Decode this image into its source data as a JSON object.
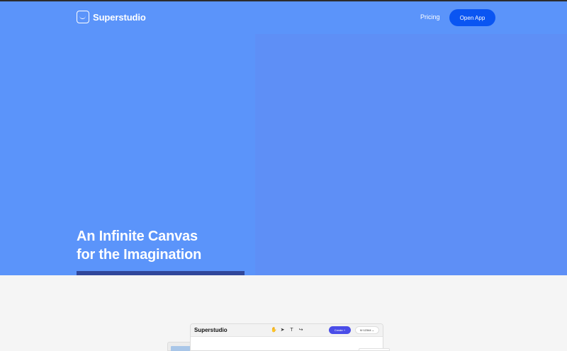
{
  "brand": {
    "name": "Superstudio"
  },
  "nav": {
    "pricing_label": "Pricing",
    "open_app_label": "Open App"
  },
  "hero": {
    "headline_line1": "An Infinite Canvas",
    "headline_line2": "for the Imagination",
    "background_color": "#5b94fa",
    "accent_color": "#0a55f2"
  },
  "preview": {
    "brand_name": "Superstudio",
    "tools": [
      "hand-icon",
      "pointer-icon",
      "text-icon",
      "share-icon"
    ],
    "create_label": "Create +",
    "credits_label": "12344"
  }
}
